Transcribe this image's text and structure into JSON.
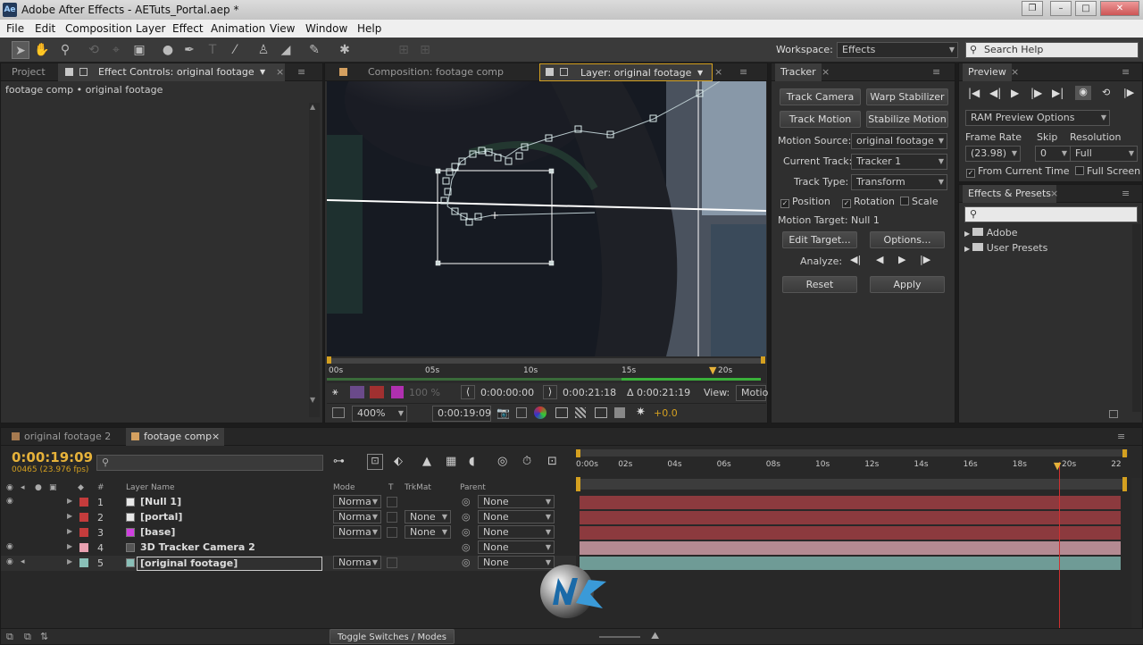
{
  "app": {
    "title": "Adobe After Effects - AETuts_Portal.aep *",
    "logo": "Ae"
  },
  "menu": [
    "File",
    "Edit",
    "Composition",
    "Layer",
    "Effect",
    "Animation",
    "View",
    "Window",
    "Help"
  ],
  "toolbar": {
    "workspace_label": "Workspace:",
    "workspace_value": "Effects",
    "search_placeholder": "Search Help"
  },
  "project_panel": {
    "tab_project": "Project",
    "tab_effect_controls": "Effect Controls: original footage",
    "breadcrumb": "footage comp • original footage"
  },
  "viewer": {
    "tab_composition": "Composition: footage comp",
    "tab_layer": "Layer: original footage",
    "ruler_labels": [
      "00s",
      "05s",
      "10s",
      "15s",
      "20s"
    ],
    "zoom_percent": "100 %",
    "in_point": "0:00:00:00",
    "out_point": "0:00:21:18",
    "duration": "Δ 0:00:21:19",
    "view_label": "View:",
    "view_value": "Motio",
    "magnification": "400%",
    "current_time": "0:00:19:09",
    "exposure": "+0.0"
  },
  "tracker": {
    "tab": "Tracker",
    "track_camera": "Track Camera",
    "warp_stabilizer": "Warp Stabilizer",
    "track_motion": "Track Motion",
    "stabilize_motion": "Stabilize Motion",
    "motion_source_label": "Motion Source:",
    "motion_source_value": "original footage",
    "current_track_label": "Current Track:",
    "current_track_value": "Tracker 1",
    "track_type_label": "Track Type:",
    "track_type_value": "Transform",
    "position": "Position",
    "rotation": "Rotation",
    "scale": "Scale",
    "motion_target": "Motion Target: Null 1",
    "edit_target": "Edit Target...",
    "options": "Options...",
    "analyze_label": "Analyze:",
    "reset": "Reset",
    "apply": "Apply"
  },
  "preview": {
    "tab": "Preview",
    "ram_preview": "RAM Preview Options",
    "frame_rate_label": "Frame Rate",
    "skip_label": "Skip",
    "resolution_label": "Resolution",
    "frame_rate_value": "(23.98)",
    "skip_value": "0",
    "resolution_value": "Full",
    "from_current_time": "From Current Time",
    "full_screen": "Full Screen"
  },
  "effects_presets": {
    "tab": "Effects & Presets",
    "items": [
      "Adobe",
      "User Presets"
    ]
  },
  "timeline": {
    "tab1": "original footage 2",
    "tab2": "footage comp",
    "timecode": "0:00:19:09",
    "frame_info": "00465 (23.976 fps)",
    "col_num": "#",
    "col_layer_name": "Layer Name",
    "col_mode": "Mode",
    "col_t": "T",
    "col_trkmat": "TrkMat",
    "col_parent": "Parent",
    "ruler_labels": [
      "0:00s",
      "02s",
      "04s",
      "06s",
      "08s",
      "10s",
      "12s",
      "14s",
      "16s",
      "18s",
      "20s",
      "22"
    ],
    "playhead_fraction": 0.883,
    "layers": [
      {
        "num": "1",
        "name": "[Null 1]",
        "color": "#c43c3c",
        "icon_color": "#e8e8e8",
        "mode": "Norma",
        "trkmat": "",
        "parent": "None",
        "bar": "#8c3a3e"
      },
      {
        "num": "2",
        "name": "[portal]",
        "color": "#c43c3c",
        "icon_color": "#e8e8e8",
        "mode": "Norma",
        "trkmat": "None",
        "parent": "None",
        "bar": "#8c3a3e"
      },
      {
        "num": "3",
        "name": "[base]",
        "color": "#c43c3c",
        "icon_color": "#d040e0",
        "mode": "Norma",
        "trkmat": "None",
        "parent": "None",
        "bar": "#8c3a3e"
      },
      {
        "num": "4",
        "name": "3D Tracker Camera 2",
        "color": "#e8a0b0",
        "icon_color": "#555555",
        "mode": "",
        "trkmat": "",
        "parent": "None",
        "bar": "#b48a92"
      },
      {
        "num": "5",
        "name": "[original footage]",
        "color": "#8ac0b8",
        "icon_color": "#8ac0b8",
        "mode": "Norma",
        "trkmat": "",
        "parent": "None",
        "bar": "#6f9b96"
      }
    ],
    "toggle_label": "Toggle Switches / Modes"
  }
}
